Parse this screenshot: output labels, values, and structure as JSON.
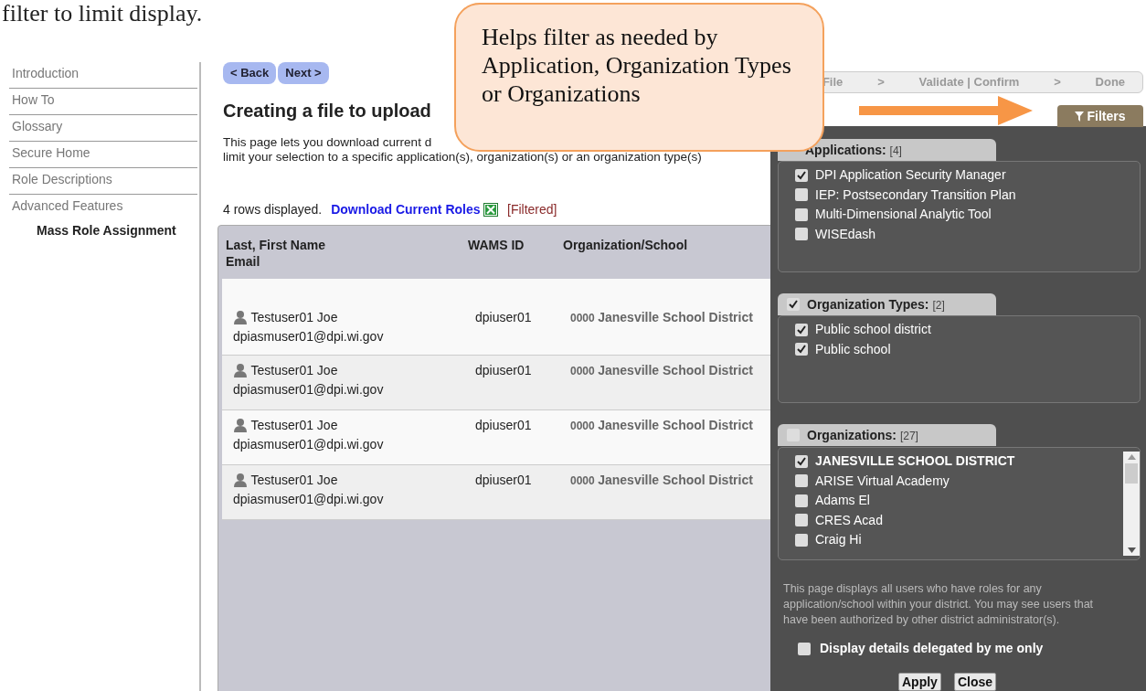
{
  "document_text": "filter to limit display.",
  "sidebar": {
    "items": [
      {
        "label": "Introduction",
        "selected": false
      },
      {
        "label": "How To",
        "selected": false
      },
      {
        "label": "Glossary",
        "selected": false
      },
      {
        "label": "Secure Home",
        "selected": false
      },
      {
        "label": "Role Descriptions",
        "selected": false
      },
      {
        "label": "Advanced Features",
        "selected": false,
        "children": [
          {
            "label": "Mass Role Assignment",
            "selected": true
          }
        ]
      }
    ]
  },
  "nav_buttons": [
    "< Back",
    "Next >"
  ],
  "title": "Creating a file to upload",
  "description_lines": [
    "This page lets you download current d",
    "limit your selection to a specific application(s), organization(s) or an organization type(s)"
  ],
  "rows_info": "4 rows displayed.",
  "download_link": "Download Current Roles",
  "filtered_label": "[Filtered]",
  "table": {
    "columns": [
      {
        "label": "Last, First Name",
        "sublabel": "Email"
      },
      {
        "label": "WAMS ID"
      },
      {
        "label": "Organization/School"
      }
    ],
    "rows": [
      {
        "name": "Testuser01 Joe",
        "email": "dpiasmuser01@dpi.wi.gov",
        "wams_id": "dpiuser01",
        "org_code": "0000",
        "org_name": "Janesville School District"
      },
      {
        "name": "Testuser01 Joe",
        "email": "dpiasmuser01@dpi.wi.gov",
        "wams_id": "dpiuser01",
        "org_code": "0000",
        "org_name": "Janesville School District"
      },
      {
        "name": "Testuser01 Joe",
        "email": "dpiasmuser01@dpi.wi.gov",
        "wams_id": "dpiuser01",
        "org_code": "0000",
        "org_name": "Janesville School District"
      },
      {
        "name": "Testuser01 Joe",
        "email": "dpiasmuser01@dpi.wi.gov",
        "wams_id": "dpiuser01",
        "org_code": "0000",
        "org_name": "Janesville School District"
      }
    ]
  },
  "steps": [
    {
      "label": "File"
    },
    {
      "label": ">"
    },
    {
      "label": "Validate | Confirm"
    },
    {
      "label": ">"
    },
    {
      "label": "Done"
    }
  ],
  "callout": "Helps filter as needed by Application, Organization Types or Organizations",
  "filters_tab": "Filters",
  "filter_sections": [
    {
      "title": "Applications:",
      "count": "[4]",
      "items": [
        {
          "label": "DPI Application Security Manager",
          "checked": true
        },
        {
          "label": "IEP: Postsecondary Transition Plan",
          "checked": false
        },
        {
          "label": "Multi-Dimensional Analytic Tool",
          "checked": false
        },
        {
          "label": "WISEdash",
          "checked": false
        }
      ]
    },
    {
      "title": "Organization Types:",
      "count": "[2]",
      "checked": true,
      "items": [
        {
          "label": "Public school district",
          "checked": true
        },
        {
          "label": "Public school",
          "checked": true
        }
      ]
    },
    {
      "title": "Organizations:",
      "count": "[27]",
      "checked": false,
      "scroll": true,
      "items": [
        {
          "label": "JANESVILLE SCHOOL DISTRICT",
          "checked": true,
          "bold": true
        },
        {
          "label": "ARISE Virtual Academy",
          "checked": false
        },
        {
          "label": "Adams El",
          "checked": false
        },
        {
          "label": "CRES Acad",
          "checked": false
        },
        {
          "label": "Craig Hi",
          "checked": false
        }
      ]
    }
  ],
  "filter_note": "This page displays all users who have roles for any application/school within your district. You may see users that have been authorized by other district administrator(s).",
  "delegated_option": {
    "label": "Display details delegated by me only",
    "checked": false
  },
  "filter_buttons": [
    "Apply",
    "Close"
  ]
}
